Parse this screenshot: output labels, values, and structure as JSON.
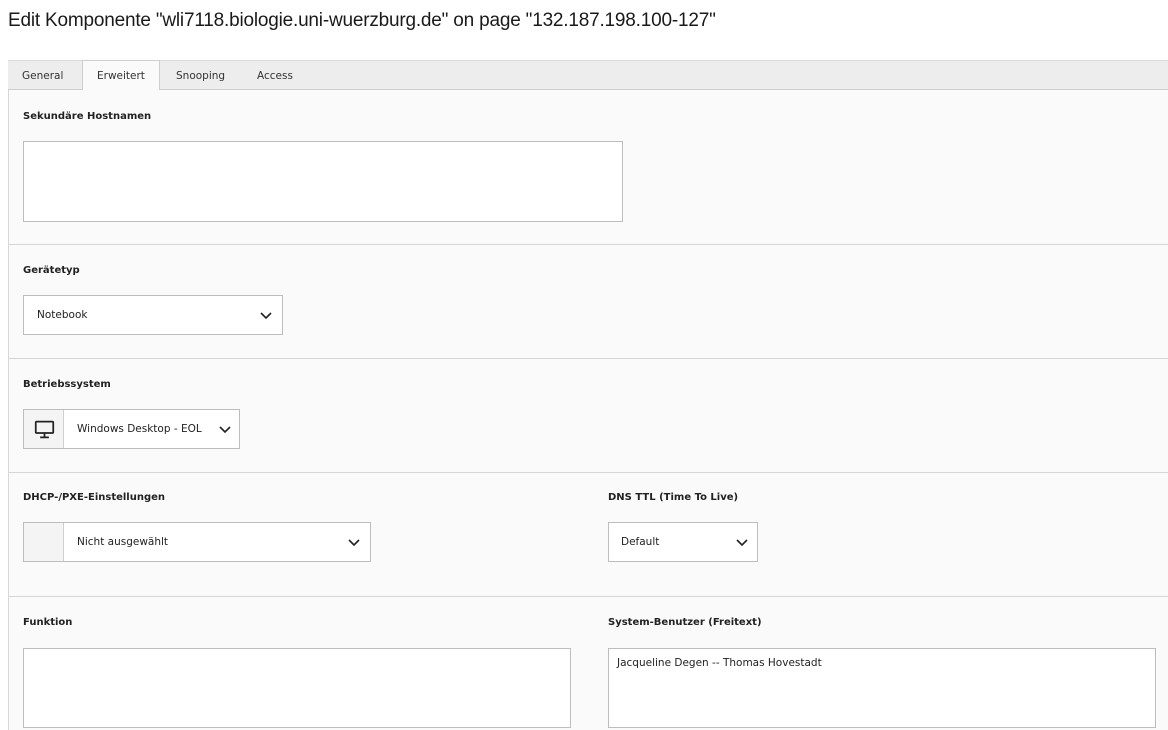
{
  "page": {
    "title": "Edit Komponente \"wli7118.biologie.uni-wuerzburg.de\" on page \"132.187.198.100-127\""
  },
  "tabs": [
    {
      "label": "General"
    },
    {
      "label": "Erweitert"
    },
    {
      "label": "Snooping"
    },
    {
      "label": "Access"
    }
  ],
  "active_tab": "Erweitert",
  "fields": {
    "secondary_hostnames": {
      "label": "Sekundäre Hostnamen",
      "value": ""
    },
    "device_type": {
      "label": "Gerätetyp",
      "value": "Notebook"
    },
    "os": {
      "label": "Betriebssystem",
      "value": "Windows Desktop - EOL",
      "icon": "monitor-icon"
    },
    "dhcp": {
      "label": "DHCP-/PXE-Einstellungen",
      "value": "Nicht ausgewählt"
    },
    "dns_ttl": {
      "label": "DNS TTL (Time To Live)",
      "value": "Default"
    },
    "function": {
      "label": "Funktion",
      "value": ""
    },
    "system_users": {
      "label": "System-Benutzer (Freitext)",
      "value": "Jacqueline Degen -- Thomas Hovestadt"
    }
  }
}
